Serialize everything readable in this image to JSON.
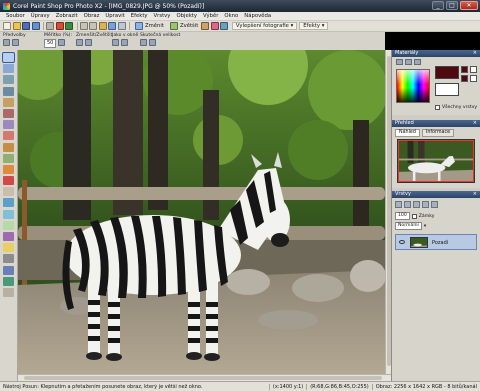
{
  "window": {
    "title": "Corel Paint Shop Pro Photo X2 - [IMG_0829.JPG @ 50% (Pozadí)]",
    "minimize": "_",
    "maximize": "□",
    "close": "✕"
  },
  "menu": [
    "Soubor",
    "Úpravy",
    "Zobrazit",
    "Obraz",
    "Upravit",
    "Efekty",
    "Vrstvy",
    "Objekty",
    "Výběr",
    "Okno",
    "Nápověda"
  ],
  "toolbar": {
    "zmenit_label": "Změnit",
    "zvetsit_label": "Zvětšit",
    "vylepseni_label": "Vylepšení fotografie",
    "efekty_label": "Efekty"
  },
  "options": {
    "presets_label": "Předvolby",
    "zoom_label": "Měřítko (%):",
    "zoom_value": "50",
    "zoom_step_label": "Zmenšit/Zvětšit",
    "fit_label": "Jako v okně",
    "actual_label": "Skutečná velikost"
  },
  "materials": {
    "title": "Materiály",
    "fg_color": "#4e0a10",
    "bg_color": "#ffffff",
    "check_label": "Všechny vrstvy"
  },
  "overview": {
    "title": "Přehled",
    "tabs": [
      "Náhled",
      "Informace"
    ]
  },
  "layers": {
    "title": "Vrstvy",
    "opacity_value": "100",
    "mode_value": "Normální",
    "lock_label": "Zámky",
    "layer_name": "Pozadí"
  },
  "status": {
    "message": "Nástroj Posun: Klepnutím a přetažením posunete obraz, který je větší než okno.",
    "coords": "(x:1400 y:1)",
    "color": "(R:68,G:86,B:45,O:255)",
    "dimensions": "Obraz: 2256 x 1642 x RGB - 8 bitů/kanál"
  }
}
